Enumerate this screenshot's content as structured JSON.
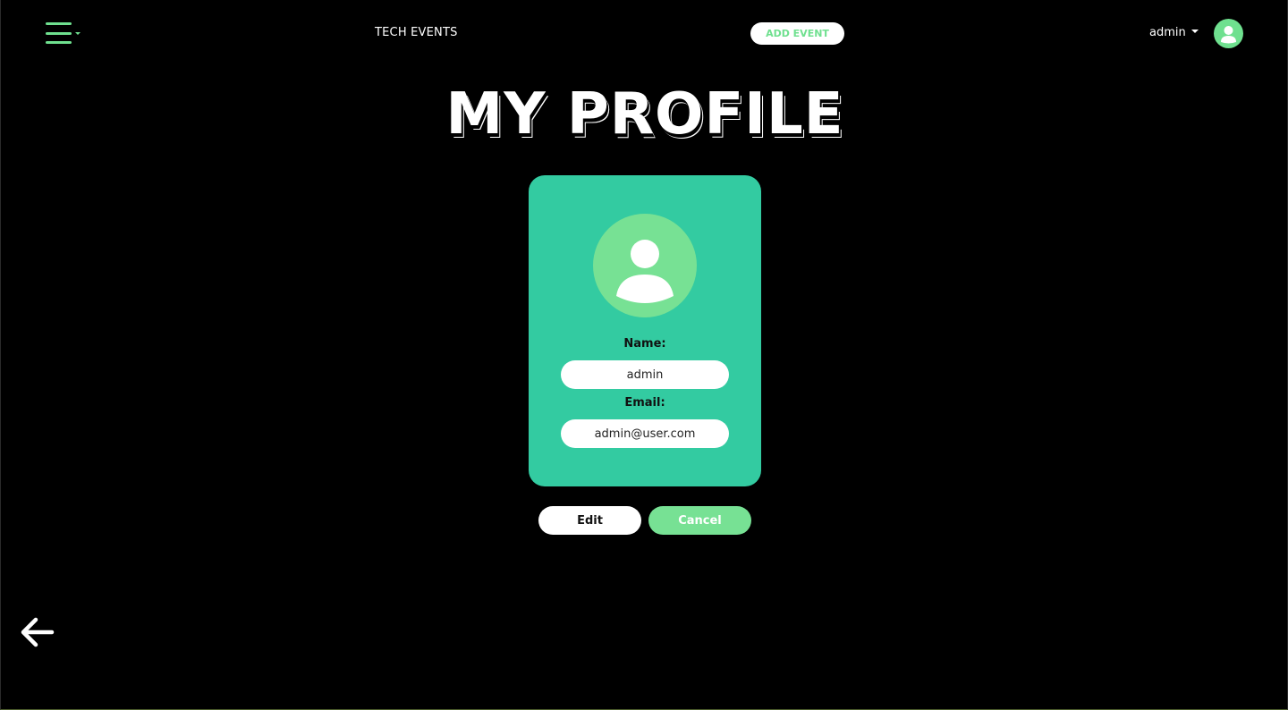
{
  "header": {
    "brand": "TECH EVENTS",
    "add_event_label": "ADD EVENT",
    "username": "admin",
    "menu_icon": "hamburger-menu-icon",
    "avatar_icon": "user-avatar-icon"
  },
  "page": {
    "title": "MY PROFILE"
  },
  "profile": {
    "avatar_icon": "user-silhouette-icon",
    "name_label": "Name:",
    "name_value": "admin",
    "email_label": "Email:",
    "email_value": "admin@user.com"
  },
  "actions": {
    "edit_label": "Edit",
    "cancel_label": "Cancel"
  },
  "navigation": {
    "back_icon": "arrow-left-icon"
  },
  "colors": {
    "background": "#000000",
    "accent_green": "#6fe08f",
    "card_teal": "#33cba1",
    "avatar_green": "#77e194",
    "white": "#ffffff"
  }
}
